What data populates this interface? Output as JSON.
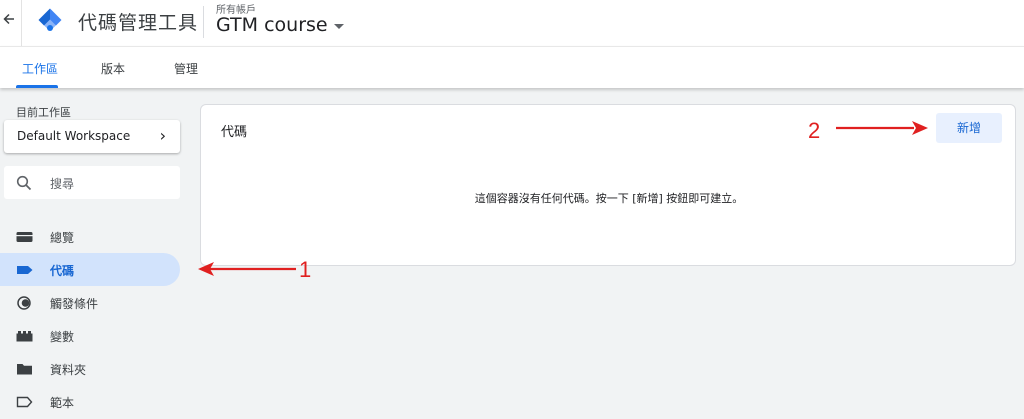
{
  "header": {
    "back_icon": "arrow-back-icon",
    "logo_icon": "gtm-diamond-logo",
    "app_title": "代碼管理工具",
    "account_label": "所有帳戶",
    "account_name": "GTM course",
    "brand_color": "#1a73e8"
  },
  "tabs": [
    {
      "label": "工作區",
      "active": true
    },
    {
      "label": "版本",
      "active": false
    },
    {
      "label": "管理",
      "active": false
    }
  ],
  "sidebar": {
    "workspace_label": "目前工作區",
    "workspace_name": "Default Workspace",
    "search_placeholder": "搜尋",
    "items": [
      {
        "label": "總覽",
        "icon": "overview-icon"
      },
      {
        "label": "代碼",
        "icon": "tag-icon",
        "active": true
      },
      {
        "label": "觸發條件",
        "icon": "trigger-icon"
      },
      {
        "label": "變數",
        "icon": "variables-icon"
      },
      {
        "label": "資料夾",
        "icon": "folder-icon"
      },
      {
        "label": "範本",
        "icon": "template-icon"
      }
    ]
  },
  "main": {
    "panel_title": "代碼",
    "new_button": "新增",
    "empty_message": "這個容器沒有任何代碼。按一下 [新增] 按鈕即可建立。"
  },
  "annotations": {
    "label_1": "1",
    "label_2": "2",
    "arrow_color": "#e02020"
  }
}
